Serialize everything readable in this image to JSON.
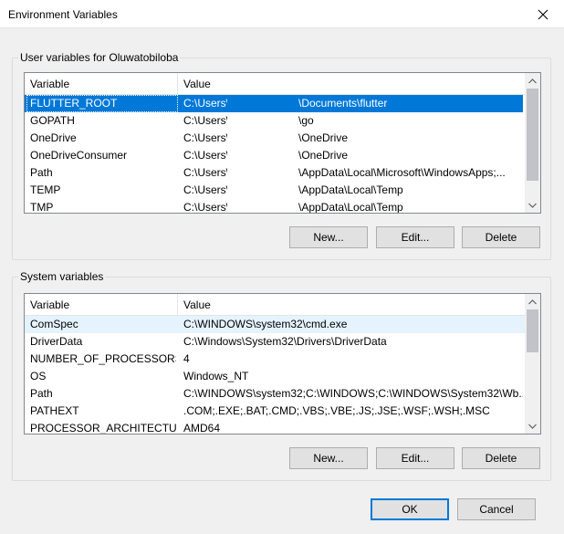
{
  "window": {
    "title": "Environment Variables",
    "close_icon": "close-icon"
  },
  "user_vars": {
    "group_label": "User variables for Oluwatobiloba",
    "columns": [
      "Variable",
      "Value"
    ],
    "rows": [
      {
        "name": "FLUTTER_ROOT",
        "value_prefix": "C:\\Users\\",
        "value_suffix": "\\Documents\\flutter"
      },
      {
        "name": "GOPATH",
        "value_prefix": "C:\\Users\\",
        "value_suffix": "\\go"
      },
      {
        "name": "OneDrive",
        "value_prefix": "C:\\Users\\",
        "value_suffix": "\\OneDrive"
      },
      {
        "name": "OneDriveConsumer",
        "value_prefix": "C:\\Users\\",
        "value_suffix": "\\OneDrive"
      },
      {
        "name": "Path",
        "value_prefix": "C:\\Users\\",
        "value_suffix": "\\AppData\\Local\\Microsoft\\WindowsApps;..."
      },
      {
        "name": "TEMP",
        "value_prefix": "C:\\Users\\",
        "value_suffix": "\\AppData\\Local\\Temp"
      },
      {
        "name": "TMP",
        "value_prefix": "C:\\Users\\",
        "value_suffix": "\\AppData\\Local\\Temp"
      }
    ],
    "selected_index": 0,
    "buttons": {
      "new": "New...",
      "edit": "Edit...",
      "delete": "Delete"
    }
  },
  "system_vars": {
    "group_label": "System variables",
    "columns": [
      "Variable",
      "Value"
    ],
    "rows": [
      {
        "name": "ComSpec",
        "value": "C:\\WINDOWS\\system32\\cmd.exe"
      },
      {
        "name": "DriverData",
        "value": "C:\\Windows\\System32\\Drivers\\DriverData"
      },
      {
        "name": "NUMBER_OF_PROCESSORS",
        "value": "4"
      },
      {
        "name": "OS",
        "value": "Windows_NT"
      },
      {
        "name": "Path",
        "value": "C:\\WINDOWS\\system32;C:\\WINDOWS;C:\\WINDOWS\\System32\\Wb..."
      },
      {
        "name": "PATHEXT",
        "value": ".COM;.EXE;.BAT;.CMD;.VBS;.VBE;.JS;.JSE;.WSF;.WSH;.MSC"
      },
      {
        "name": "PROCESSOR_ARCHITECTURE",
        "value": "AMD64"
      }
    ],
    "hover_index": 0,
    "buttons": {
      "new": "New...",
      "edit": "Edit...",
      "delete": "Delete"
    }
  },
  "footer": {
    "ok": "OK",
    "cancel": "Cancel"
  },
  "colors": {
    "selection": "#0078d7",
    "hover": "#e5f3ff",
    "background": "#f0f0f0"
  }
}
